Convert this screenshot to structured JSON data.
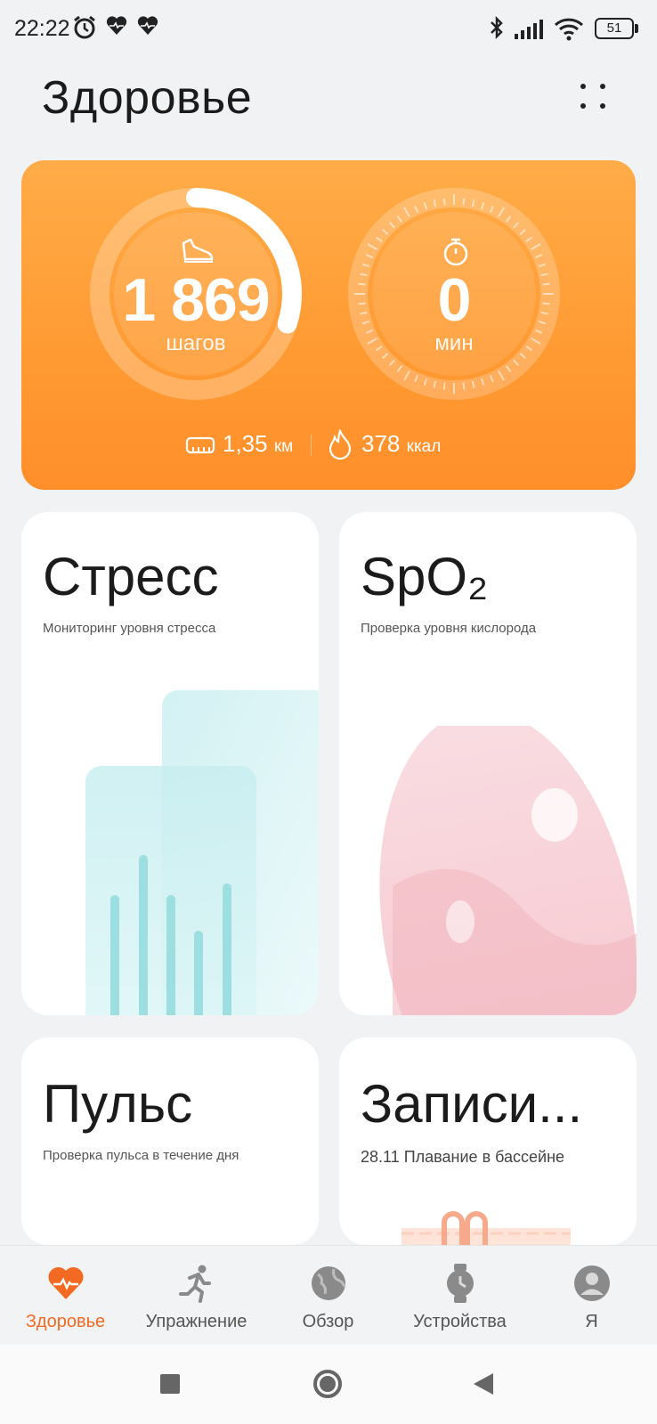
{
  "status_bar": {
    "time": "22:22",
    "battery": "51",
    "icons": [
      "alarm-icon",
      "heart-rate-icon",
      "heart-rate-icon",
      "bluetooth-icon",
      "signal-icon",
      "wifi-icon",
      "battery-icon"
    ]
  },
  "header": {
    "title": "Здоровье",
    "menu_icon": "more-dots-icon"
  },
  "activity": {
    "steps_value": "1 869",
    "steps_unit": "шагов",
    "steps_progress": 0.3,
    "minutes_value": "0",
    "minutes_unit": "мин",
    "distance_value": "1,35",
    "distance_unit": "км",
    "calories_value": "378",
    "calories_unit": "ккал",
    "accent_color": "#ff9a32"
  },
  "tiles": {
    "stress": {
      "title": "Стресс",
      "subtitle": "Мониторинг уровня стресса"
    },
    "spo2": {
      "title": "SpO₂",
      "subtitle": "Проверка уровня кислорода"
    },
    "pulse": {
      "title": "Пульс",
      "subtitle": "Проверка пульса в течение дня"
    },
    "records": {
      "title": "Записи...",
      "date": "28.11",
      "activity": "Плавание в бассейне"
    }
  },
  "bottom_nav": {
    "items": [
      {
        "label": "Здоровье",
        "icon": "heart-icon",
        "active": true
      },
      {
        "label": "Упражнение",
        "icon": "running-icon",
        "active": false
      },
      {
        "label": "Обзор",
        "icon": "globe-icon",
        "active": false
      },
      {
        "label": "Устройства",
        "icon": "watch-icon",
        "active": false
      },
      {
        "label": "Я",
        "icon": "profile-icon",
        "active": false
      }
    ],
    "active_color": "#f26a21"
  },
  "system_nav": {
    "icons": [
      "recents-square-icon",
      "home-circle-icon",
      "back-triangle-icon"
    ]
  }
}
